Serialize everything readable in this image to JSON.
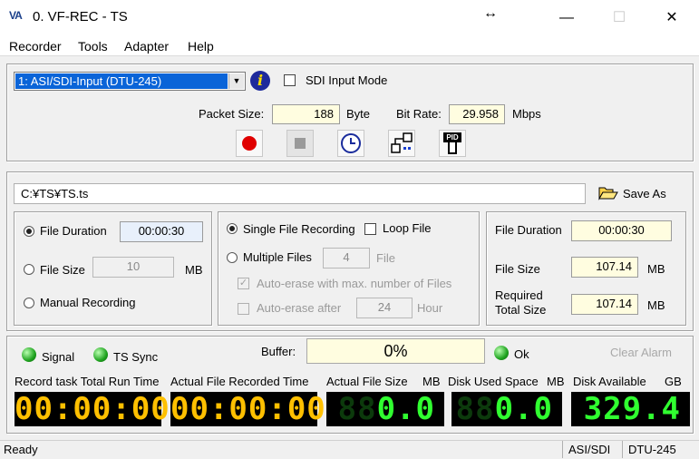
{
  "window": {
    "app_logo": "VA",
    "title": "0. VF-REC - TS",
    "minimize": "—",
    "maximize": "☐",
    "close": "✕"
  },
  "menu": [
    "Recorder",
    "Tools",
    "Adapter",
    "Help"
  ],
  "input": {
    "adapter_value": "1: ASI/SDI-Input (DTU-245)",
    "sdi_mode_label": "SDI Input Mode",
    "sdi_mode_checked": false,
    "packet_size_label": "Packet Size:",
    "packet_size": "188",
    "packet_size_unit": "Byte",
    "bit_rate_label": "Bit Rate:",
    "bit_rate": "29.958",
    "bit_rate_unit": "Mbps"
  },
  "toolbar": {
    "icons": [
      "record-icon",
      "stop-icon",
      "clock-icon",
      "network-icon",
      "pid-icon"
    ],
    "pid_text": "PID"
  },
  "output": {
    "file_path": "C:¥TS¥TS.ts",
    "save_as_label": "Save As"
  },
  "duration_options": {
    "file_duration_label": "File Duration",
    "file_duration_value": "00:00:30",
    "file_size_label": "File Size",
    "file_size_value": "10",
    "file_size_unit": "MB",
    "manual_label": "Manual Recording",
    "selected": "file_duration"
  },
  "file_mode": {
    "single_label": "Single File Recording",
    "loop_label": "Loop File",
    "multiple_label": "Multiple Files",
    "multiple_count": "4",
    "multiple_unit": "File",
    "auto_erase_max_label": "Auto-erase with max. number of Files",
    "auto_erase_after_label": "Auto-erase after",
    "auto_erase_after_value": "24",
    "auto_erase_after_unit": "Hour",
    "selected": "single"
  },
  "summary": {
    "file_duration_label": "File Duration",
    "file_duration_value": "00:00:30",
    "file_size_label": "File Size",
    "file_size_value": "107.14",
    "file_size_unit": "MB",
    "required_label_1": "Required",
    "required_label_2": "Total Size",
    "required_value": "107.14",
    "required_unit": "MB"
  },
  "status": {
    "signal_label": "Signal",
    "ts_sync_label": "TS Sync",
    "buffer_label": "Buffer:",
    "buffer_value": "0%",
    "ok_label": "Ok",
    "clear_alarm_label": "Clear Alarm"
  },
  "displays": {
    "total_run_label": "Record task Total Run Time",
    "total_run_value": "00:00:00",
    "file_recorded_label": "Actual File Recorded Time",
    "file_recorded_value": "00:00:00",
    "actual_size_label": "Actual File Size",
    "actual_size_unit": "MB",
    "actual_size_dim": "88",
    "actual_size_value": "0.0",
    "disk_used_label": "Disk Used Space",
    "disk_used_unit": "MB",
    "disk_used_dim": "88",
    "disk_used_value": "0.0",
    "disk_avail_label": "Disk Available",
    "disk_avail_unit": "GB",
    "disk_avail_value": "329.4"
  },
  "statusbar": {
    "state": "Ready",
    "mode": "ASI/SDI",
    "device": "DTU-245"
  },
  "colors": {
    "field_bg": "#fffde0",
    "led_green": "#1fa31f",
    "seg_yellow": "#ffc000",
    "seg_green": "#30ff30",
    "select_highlight": "#0a64d8"
  }
}
